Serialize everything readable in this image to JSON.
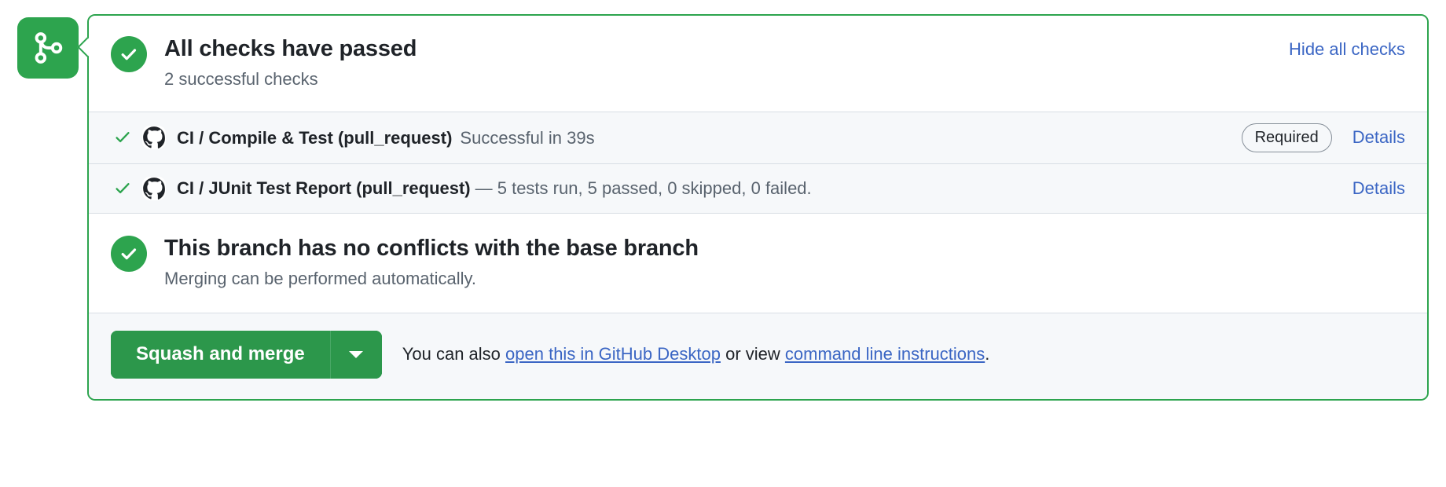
{
  "merge_state_icon": "git-merge-icon",
  "header": {
    "status_icon": "check-circle-icon",
    "title": "All checks have passed",
    "subtitle": "2 successful checks",
    "hide_checks_label": "Hide all checks"
  },
  "checks": [
    {
      "status_icon": "check-icon",
      "avatar_icon": "github-actions-avatar-icon",
      "name": "CI / Compile & Test (pull_request)",
      "description": "Successful in 39s",
      "required_label": "Required",
      "details_label": "Details"
    },
    {
      "status_icon": "check-icon",
      "avatar_icon": "github-actions-avatar-icon",
      "name": "CI / JUnit Test Report (pull_request)",
      "description": "— 5 tests run, 5 passed, 0 skipped, 0 failed.",
      "required_label": null,
      "details_label": "Details"
    }
  ],
  "conflicts": {
    "status_icon": "check-circle-icon",
    "title": "This branch has no conflicts with the base branch",
    "subtitle": "Merging can be performed automatically."
  },
  "footer": {
    "merge_button_label": "Squash and merge",
    "merge_dropdown_icon": "chevron-down-icon",
    "note_prefix": "You can also ",
    "desktop_link": "open this in GitHub Desktop",
    "note_middle": " or view ",
    "cli_link": "command line instructions",
    "note_suffix": "."
  },
  "colors": {
    "success_green": "#2da44e",
    "button_green": "#2c974b",
    "link_blue": "#3b66c4",
    "muted_text": "#59636e",
    "row_background": "#f6f8fa",
    "border": "#d8dee4"
  }
}
